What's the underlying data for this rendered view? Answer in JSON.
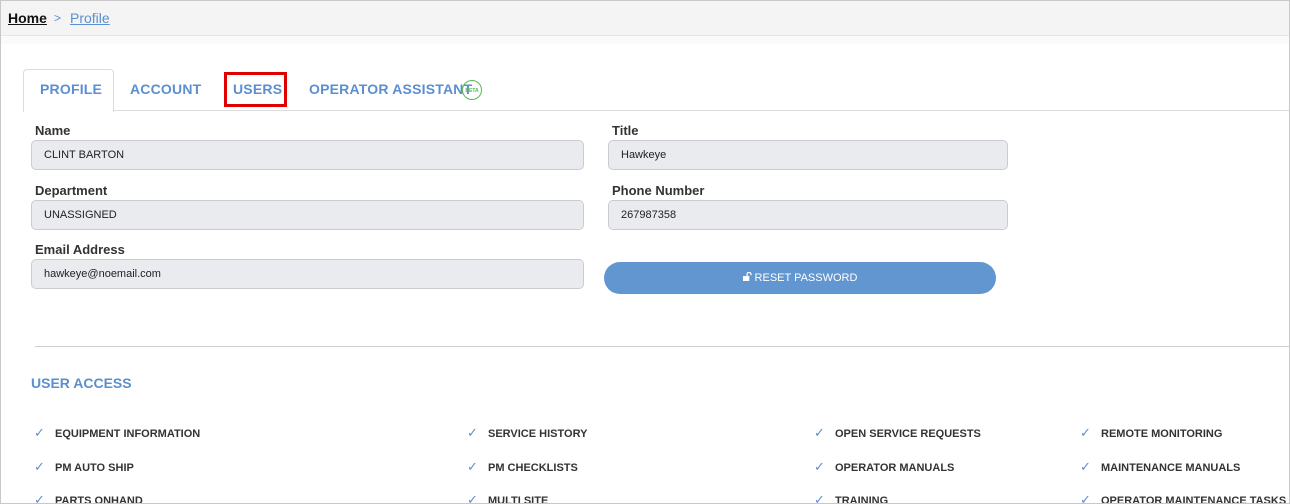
{
  "breadcrumb": {
    "home": "Home",
    "separator": ">",
    "current": "Profile"
  },
  "tabs": {
    "profile": "PROFILE",
    "account": "ACCOUNT",
    "users": "USERS",
    "operator_assistant": "OPERATOR ASSISTANT",
    "beta_badge": "BETA"
  },
  "form": {
    "name_label": "Name",
    "name_value": "CLINT BARTON",
    "title_label": "Title",
    "title_value": "Hawkeye",
    "department_label": "Department",
    "department_value": "UNASSIGNED",
    "phone_label": "Phone Number",
    "phone_value": "267987358",
    "email_label": "Email Address",
    "email_value": "hawkeye@noemail.com",
    "reset_button": "RESET PASSWORD",
    "reset_icon": "lock-open-icon"
  },
  "user_access": {
    "title": "USER ACCESS",
    "check_icon": "check-icon",
    "items": [
      "EQUIPMENT INFORMATION",
      "SERVICE HISTORY",
      "OPEN SERVICE REQUESTS",
      "REMOTE MONITORING",
      "PM AUTO SHIP",
      "PM CHECKLISTS",
      "OPERATOR MANUALS",
      "MAINTENANCE MANUALS",
      "PARTS ONHAND",
      "MULTI SITE",
      "TRAINING",
      "OPERATOR MAINTENANCE TASKS"
    ]
  },
  "colors": {
    "accent": "#5b8fcf",
    "button": "#6296d0",
    "highlight": "#e00000",
    "beta": "#57b957"
  }
}
